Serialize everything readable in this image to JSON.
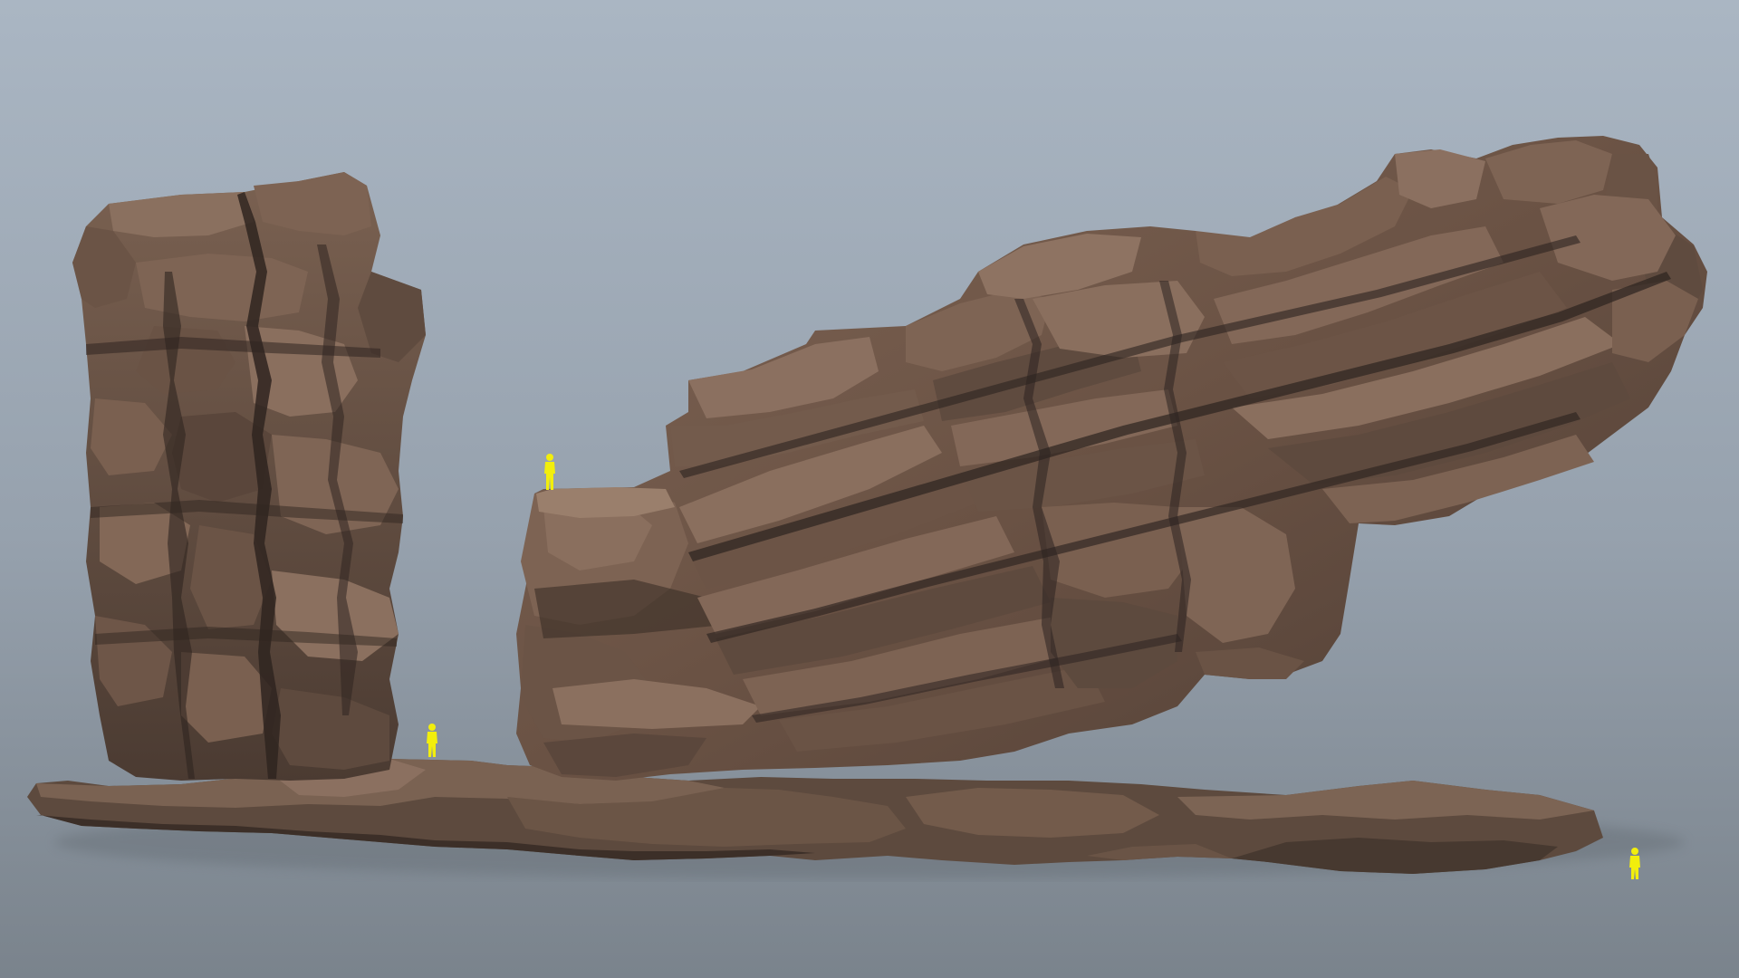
{
  "scene": {
    "subject": "rock-formation-3d-render",
    "colors": {
      "sky_top": "#a9b5c2",
      "sky_bottom": "#7b848d",
      "rock_light": "#8a6e5c",
      "rock_mid": "#6e5647",
      "rock_dark": "#3f322b",
      "rock_shadow": "#2c2320",
      "scale_figure": "#f2ee0c"
    },
    "scale_figures": [
      "scale-figure-top-ledge",
      "scale-figure-base-gap",
      "scale-figure-right-ground"
    ]
  }
}
